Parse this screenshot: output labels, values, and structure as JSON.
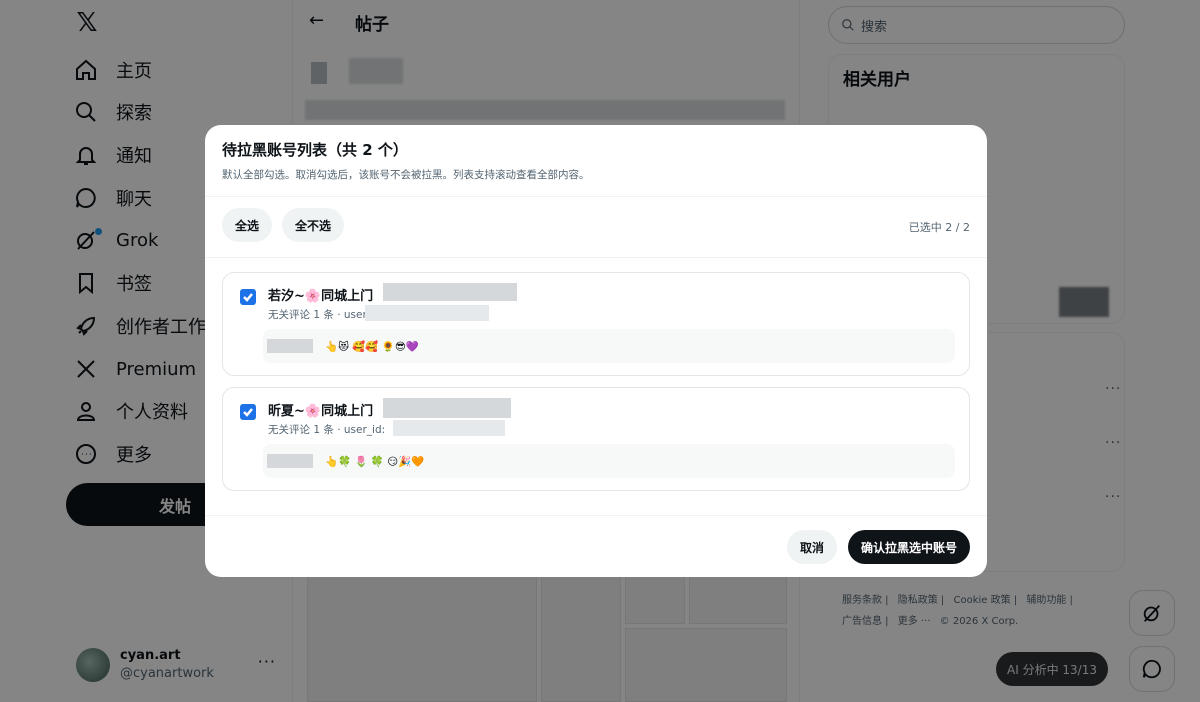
{
  "app": {
    "logo": "𝕏"
  },
  "sidebar": {
    "items": [
      {
        "label": "主页",
        "icon": "home-icon"
      },
      {
        "label": "探索",
        "icon": "search-icon"
      },
      {
        "label": "通知",
        "icon": "bell-icon"
      },
      {
        "label": "聊天",
        "icon": "chat-icon"
      },
      {
        "label": "Grok",
        "icon": "grok-icon"
      },
      {
        "label": "书签",
        "icon": "bookmark-icon"
      },
      {
        "label": "创作者工作室",
        "icon": "rocket-icon"
      },
      {
        "label": "Premium",
        "icon": "x-logo-icon"
      },
      {
        "label": "个人资料",
        "icon": "person-icon"
      },
      {
        "label": "更多",
        "icon": "more-circle-icon"
      }
    ],
    "post_button": "发帖",
    "account": {
      "name": "cyan.art",
      "handle": "@cyanartwork",
      "more": "···"
    }
  },
  "main": {
    "title": "帖子",
    "back": "←"
  },
  "right": {
    "search_placeholder": "搜索",
    "related_title": "相关用户",
    "footer": [
      "服务条款 |",
      "隐私政策 |",
      "Cookie 政策 |",
      "辅助功能 |",
      "广告信息 |",
      "更多 ···",
      "© 2026 X Corp."
    ],
    "ai_status": "AI 分析中 13/13"
  },
  "modal": {
    "title": "待拉黑账号列表（共 2 个）",
    "subtitle": "默认全部勾选。取消勾选后，该账号不会被拉黑。列表支持滚动查看全部内容。",
    "select_all": "全选",
    "select_none": "全不选",
    "selected_count": "已选中 2 / 2",
    "accounts": [
      {
        "name": "若汐~🌸同城上门",
        "meta": "无关评论 1 条 · user_",
        "comment": "👆😻 🥰🥰 🌻😎💜",
        "checked": true
      },
      {
        "name": "昕夏~🌸同城上门",
        "meta": "无关评论 1 条 · user_id:",
        "comment": "👆🍀 🌷  🍀 😏🎉🧡",
        "checked": true
      }
    ],
    "cancel": "取消",
    "confirm": "确认拉黑选中账号"
  }
}
